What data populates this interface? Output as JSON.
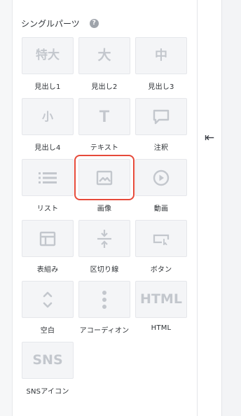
{
  "section": {
    "title": "シングルパーツ",
    "help_icon": "?"
  },
  "collapse_icon": "⇤",
  "items": [
    {
      "label": "見出し1",
      "glyph": "特大",
      "icon": "heading-large-icon"
    },
    {
      "label": "見出し2",
      "glyph": "大",
      "icon": "heading-big-icon"
    },
    {
      "label": "見出し3",
      "glyph": "中",
      "icon": "heading-medium-icon"
    },
    {
      "label": "見出し4",
      "glyph": "小",
      "icon": "heading-small-icon"
    },
    {
      "label": "テキスト",
      "glyph": "T",
      "icon": "text-icon"
    },
    {
      "label": "注釈",
      "glyph": "",
      "icon": "speech-bubble-icon"
    },
    {
      "label": "リスト",
      "glyph": "",
      "icon": "list-icon"
    },
    {
      "label": "画像",
      "glyph": "",
      "icon": "image-icon",
      "selected": true
    },
    {
      "label": "動画",
      "glyph": "",
      "icon": "play-icon"
    },
    {
      "label": "表組み",
      "glyph": "",
      "icon": "table-icon"
    },
    {
      "label": "区切り線",
      "glyph": "",
      "icon": "divider-icon"
    },
    {
      "label": "ボタン",
      "glyph": "",
      "icon": "button-icon"
    },
    {
      "label": "空白",
      "glyph": "",
      "icon": "spacer-icon"
    },
    {
      "label": "アコーディオン",
      "glyph": "",
      "icon": "accordion-icon"
    },
    {
      "label": "HTML",
      "glyph": "HTML",
      "icon": "html-icon"
    },
    {
      "label": "SNSアイコン",
      "glyph": "SNS",
      "icon": "sns-icon"
    }
  ],
  "colors": {
    "tile_bg": "#f4f5f7",
    "icon_gray": "#c3c7cd",
    "selected_outline": "#e64a3a"
  }
}
